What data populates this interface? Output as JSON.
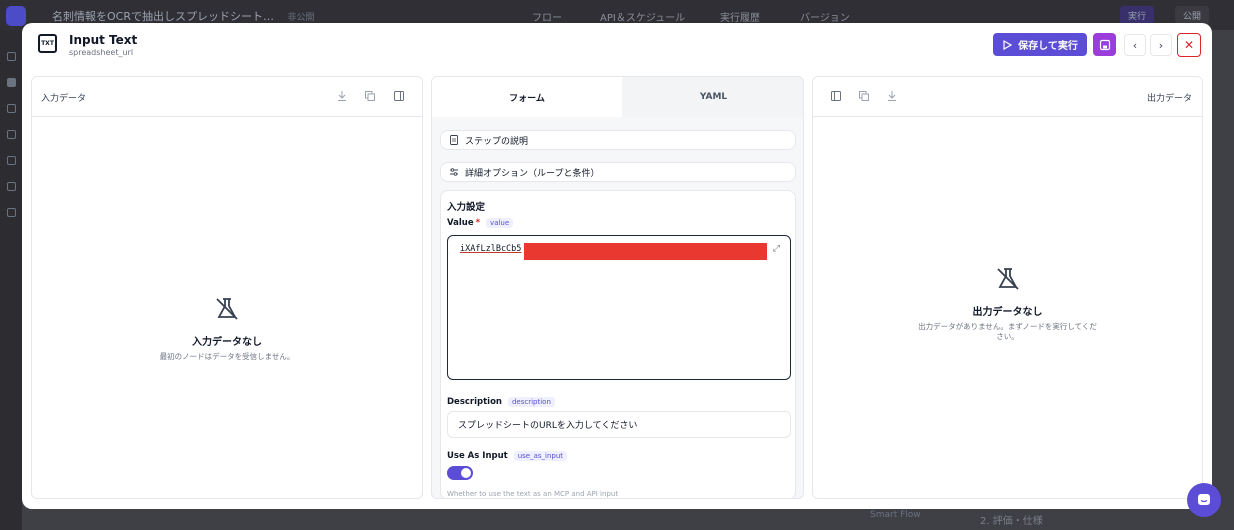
{
  "background": {
    "doc_title": "名刺情報をOCRで抽出しスプレッドシート…",
    "visibility": "非公開",
    "tabs": [
      "フロー",
      "API＆スケジュール",
      "実行履歴",
      "バージョン"
    ],
    "run_label": "実行",
    "publish_label": "公開",
    "bottom_text": "Smart Flow",
    "bottom_text_2": "2. 評価・仕様"
  },
  "modal": {
    "node_title": "Input Text",
    "node_subtitle": "spreadsheet_url",
    "save_run_label": "保存して実行",
    "prev_label": "‹",
    "next_label": "›",
    "close_label": "✕"
  },
  "input_panel": {
    "header": "入力データ",
    "empty_title": "入力データなし",
    "empty_desc": "最初のノードはデータを受信しません。"
  },
  "output_panel": {
    "header": "出力データ",
    "empty_title": "出力データなし",
    "empty_desc_line1": "出力データがありません。まずノードを実行してくだ",
    "empty_desc_line2": "さい。"
  },
  "form": {
    "tabs": {
      "form": "フォーム",
      "yaml": "YAML"
    },
    "step_desc_label": "ステップの説明",
    "advanced_label": "詳細オプション（ループと条件）",
    "section_title": "入力設定",
    "value_label": "Value",
    "value_required": "*",
    "value_tag": "value",
    "value_text": "iXAfLzlBcCb5",
    "description_label": "Description",
    "description_tag": "description",
    "description_value": "スプレッドシートのURLを入力してください",
    "use_as_input_label": "Use As Input",
    "use_as_input_tag": "use_as_input",
    "use_as_input_on": true,
    "use_as_input_hint": "Whether to use the text as an MCP and API input"
  },
  "colors": {
    "accent": "#5b4dd6",
    "save_button": "#9b3ddb",
    "close": "#dc2626",
    "redaction": "#e8382f"
  },
  "icons": [
    "node-text-icon",
    "play-icon",
    "save-icon",
    "chevron-left-icon",
    "chevron-right-icon",
    "close-icon",
    "download-icon",
    "copy-icon",
    "collapse-panel-icon",
    "flask-off-icon",
    "document-icon",
    "sliders-icon",
    "expand-icon",
    "chat-icon"
  ]
}
